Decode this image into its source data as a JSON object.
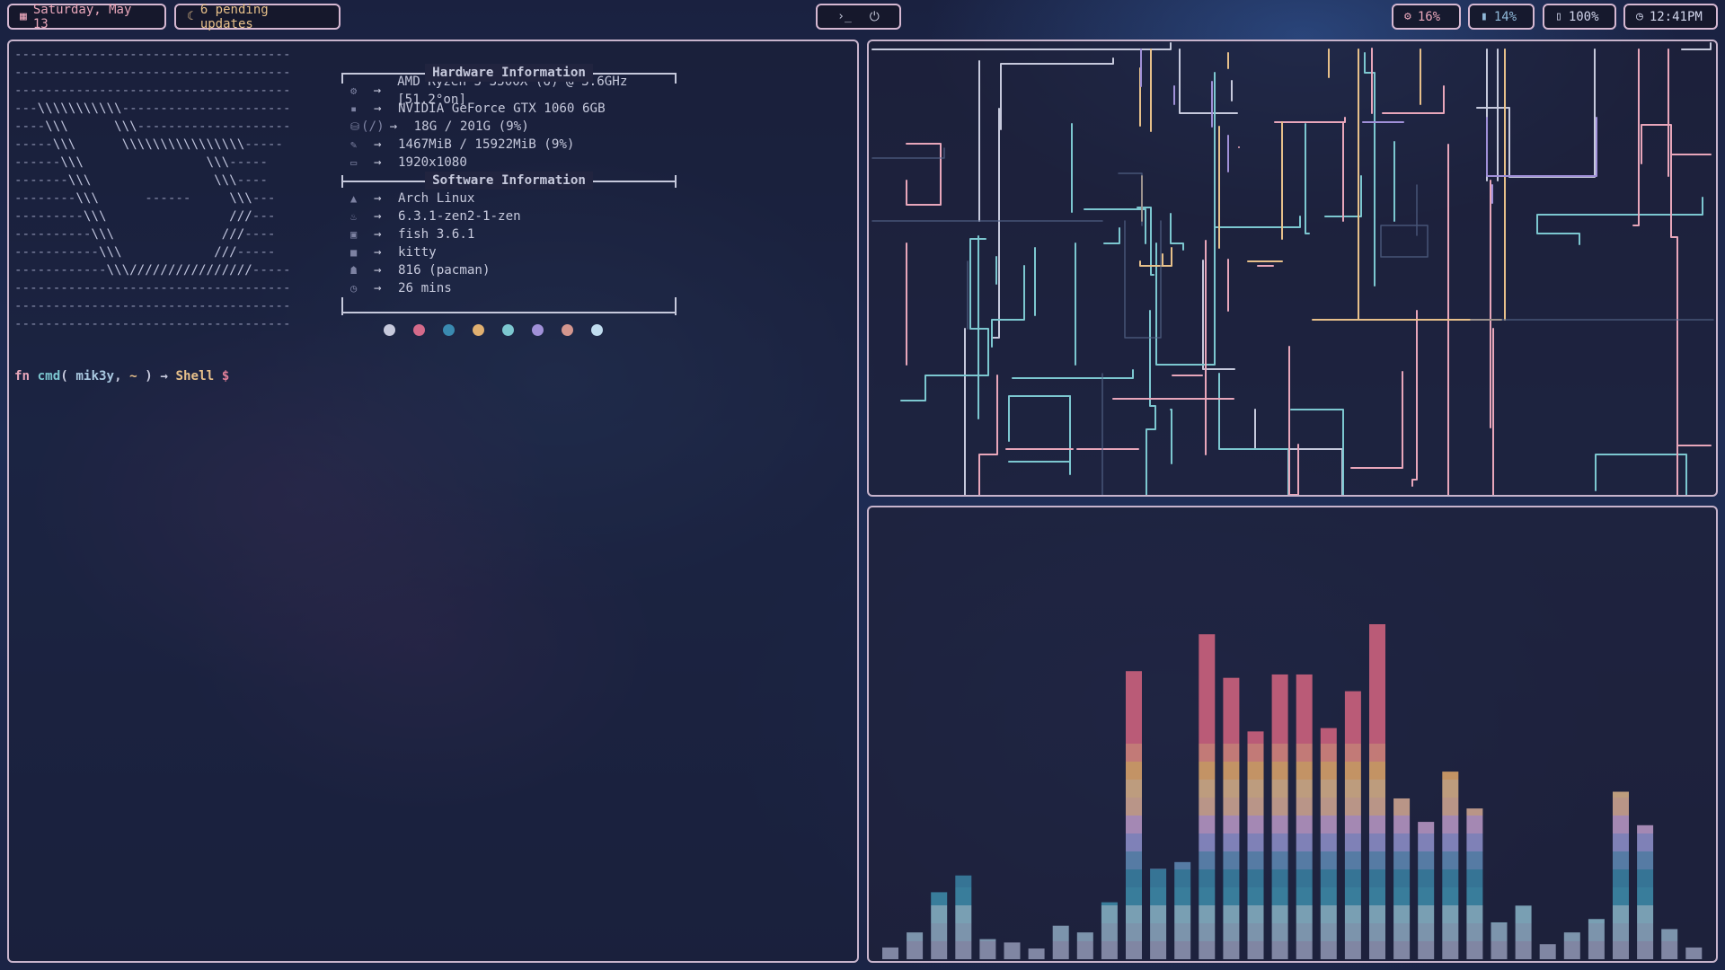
{
  "topbar": {
    "date": {
      "icon": "calendar-icon",
      "label": "Saturday, May 13",
      "color": "#e8a6ba"
    },
    "updates": {
      "icon": "moon-icon",
      "label": "6 pending updates",
      "color": "#e7c08a"
    },
    "center": {
      "terminal_glyph": "›_",
      "power_glyph": "⏻"
    },
    "cpu": {
      "icon": "cpu-icon",
      "label": "16%",
      "color": "#e8a6ba"
    },
    "memory": {
      "icon": "memory-icon",
      "label": "14%",
      "color": "#8fb8d8"
    },
    "battery": {
      "icon": "battery-icon",
      "label": "100%",
      "color": "#d0d4ea"
    },
    "clock": {
      "icon": "clock-icon",
      "label": "12:41PM",
      "color": "#d0d4ea"
    }
  },
  "terminal": {
    "hardware_title": "Hardware Information",
    "software_title": "Software Information",
    "hardware": [
      {
        "icon": "cpu-icon",
        "value": "AMD Ryzen 5 3500X (6) @ 3.6GHz [51.2°on]"
      },
      {
        "icon": "gpu-icon",
        "value": "NVIDIA GeForce GTX 1060 6GB"
      },
      {
        "icon": "disk-icon",
        "value": "18G / 201G (9%)",
        "prefix": "(/)"
      },
      {
        "icon": "memory-icon",
        "value": "1467MiB / 15922MiB (9%)"
      },
      {
        "icon": "monitor-icon",
        "value": "1920x1080"
      }
    ],
    "software": [
      {
        "icon": "arch-logo-icon",
        "value": "Arch Linux"
      },
      {
        "icon": "kernel-icon",
        "value": "6.3.1-zen2-1-zen"
      },
      {
        "icon": "shell-icon",
        "value": "fish 3.6.1"
      },
      {
        "icon": "terminal-icon",
        "value": "kitty"
      },
      {
        "icon": "package-icon",
        "value": "816 (pacman)"
      },
      {
        "icon": "uptime-icon",
        "value": "26 mins"
      }
    ],
    "arrow": "→",
    "palette": [
      "#c6c9dc",
      "#d46a8a",
      "#3a8ab0",
      "#e0b070",
      "#7cc7d0",
      "#a090d8",
      "#d4968e",
      "#c0dcef"
    ],
    "prompt": {
      "fn": "fn",
      "cmd": "cmd",
      "user": "mik3y",
      "sep": ",",
      "dir": "~",
      "close": ")",
      "arrow": "→",
      "shell": "Shell",
      "dollar": "$"
    }
  },
  "visualizer": {
    "bars": [
      0.035,
      0.08,
      0.2,
      0.25,
      0.06,
      0.05,
      0.032,
      0.1,
      0.08,
      0.17,
      0.86,
      0.27,
      0.29,
      0.97,
      0.84,
      0.68,
      0.85,
      0.85,
      0.69,
      0.8,
      1.0,
      0.48,
      0.41,
      0.56,
      0.45,
      0.11,
      0.16,
      0.045,
      0.08,
      0.12,
      0.5,
      0.4,
      0.09,
      0.035
    ]
  },
  "colors": {
    "accent": "#d6b8d2",
    "fn": "#e8a6ba",
    "cmd": "#7cc7d0",
    "user": "#a9c8e0",
    "shell": "#e7c08a",
    "dollar": "#e07f98"
  }
}
